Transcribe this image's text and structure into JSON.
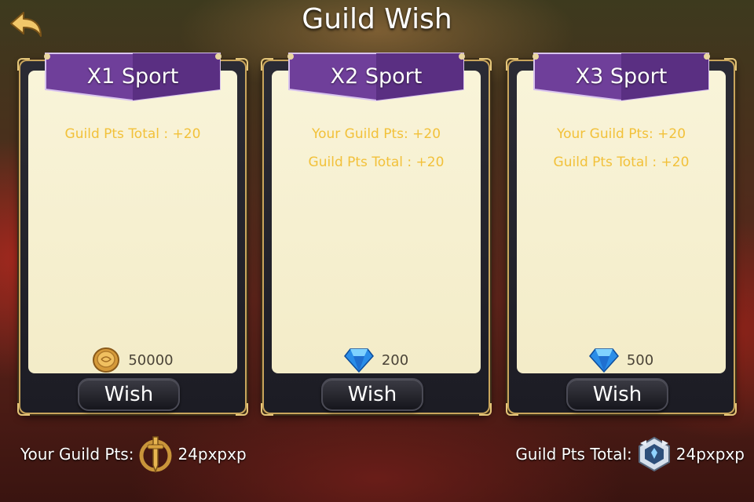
{
  "header": {
    "title": "Guild Wish",
    "back_icon": "back-arrow-icon"
  },
  "colors": {
    "ribbon": "#6f3f9a",
    "info_text": "#f2c13a",
    "frame_gold": "#c9a55c"
  },
  "cards": [
    {
      "title": "X1 Sport",
      "lines": [
        "Guild Pts Total : +20"
      ],
      "cost_icon": "gold-coin-icon",
      "cost": "50000",
      "button": "Wish"
    },
    {
      "title": "X2 Sport",
      "lines": [
        "Your Guild Pts: +20",
        "Guild Pts Total : +20"
      ],
      "cost_icon": "diamond-icon",
      "cost": "200",
      "button": "Wish"
    },
    {
      "title": "X3 Sport",
      "lines": [
        "Your Guild Pts: +20",
        "Guild Pts Total : +20"
      ],
      "cost_icon": "diamond-icon",
      "cost": "500",
      "button": "Wish"
    }
  ],
  "footer": {
    "your_label": "Your Guild Pts:",
    "your_value": "24pxpxp",
    "your_icon": "sword-emblem-icon",
    "total_label": "Guild Pts Total:",
    "total_value": "24pxpxp",
    "total_icon": "guild-crest-icon"
  }
}
